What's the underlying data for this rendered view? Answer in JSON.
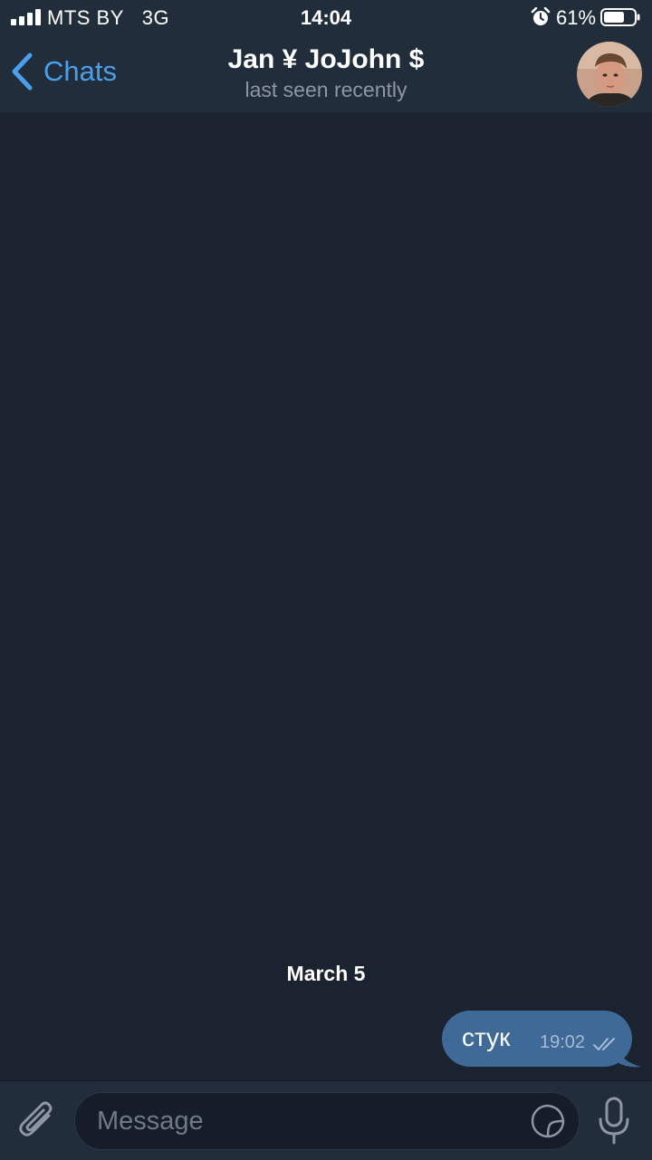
{
  "status_bar": {
    "carrier": "MTS BY",
    "network": "3G",
    "time": "14:04",
    "battery_percent": "61%",
    "icons": [
      "signal-icon",
      "alarm-icon",
      "battery-icon"
    ]
  },
  "header": {
    "back_label": "Chats",
    "title": "Jan ¥ JoJohn $",
    "subtitle": "last seen recently",
    "icons": [
      "chevron-left-icon",
      "avatar"
    ]
  },
  "chat": {
    "date_separator": "March 5",
    "messages": [
      {
        "text": "стук",
        "time": "19:02",
        "outgoing": true,
        "read": true
      }
    ]
  },
  "input": {
    "placeholder": "Message",
    "value": "",
    "icons": [
      "paperclip-icon",
      "sticker-icon",
      "microphone-icon"
    ]
  },
  "colors": {
    "background": "#1b2230",
    "bar": "#222d3b",
    "accent": "#4aa0ea",
    "outgoing_bubble": "#3f6a97"
  }
}
